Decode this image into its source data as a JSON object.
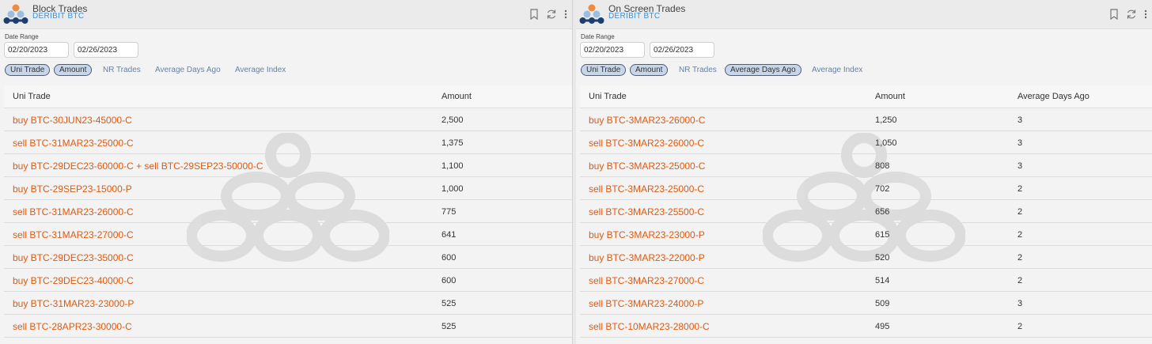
{
  "panels": [
    {
      "title": "Block Trades",
      "subtitle": "DERIBIT BTC",
      "date_range_label": "Date Range",
      "date_from": "02/20/2023",
      "date_to": "02/26/2023",
      "filters": [
        {
          "label": "Uni Trade",
          "active": true
        },
        {
          "label": "Amount",
          "active": true
        },
        {
          "label": "NR Trades",
          "active": false
        },
        {
          "label": "Average Days Ago",
          "active": false
        },
        {
          "label": "Average Index",
          "active": false
        }
      ],
      "columns": [
        "Uni Trade",
        "Amount"
      ],
      "rows": [
        [
          "buy BTC-30JUN23-45000-C",
          "2,500"
        ],
        [
          "sell BTC-31MAR23-25000-C",
          "1,375"
        ],
        [
          "buy BTC-29DEC23-60000-C + sell BTC-29SEP23-50000-C",
          "1,100"
        ],
        [
          "buy BTC-29SEP23-15000-P",
          "1,000"
        ],
        [
          "sell BTC-31MAR23-26000-C",
          "775"
        ],
        [
          "sell BTC-31MAR23-27000-C",
          "641"
        ],
        [
          "buy BTC-29DEC23-35000-C",
          "600"
        ],
        [
          "buy BTC-29DEC23-40000-C",
          "600"
        ],
        [
          "buy BTC-31MAR23-23000-P",
          "525"
        ],
        [
          "sell BTC-28APR23-30000-C",
          "525"
        ]
      ]
    },
    {
      "title": "On Screen Trades",
      "subtitle": "DERIBIT BTC",
      "date_range_label": "Date Range",
      "date_from": "02/20/2023",
      "date_to": "02/26/2023",
      "filters": [
        {
          "label": "Uni Trade",
          "active": true
        },
        {
          "label": "Amount",
          "active": true
        },
        {
          "label": "NR Trades",
          "active": false
        },
        {
          "label": "Average Days Ago",
          "active": true
        },
        {
          "label": "Average Index",
          "active": false
        }
      ],
      "columns": [
        "Uni Trade",
        "Amount",
        "Average Days Ago"
      ],
      "rows": [
        [
          "buy BTC-3MAR23-26000-C",
          "1,250",
          "3"
        ],
        [
          "sell BTC-3MAR23-26000-C",
          "1,050",
          "3"
        ],
        [
          "buy BTC-3MAR23-25000-C",
          "808",
          "3"
        ],
        [
          "sell BTC-3MAR23-25000-C",
          "702",
          "2"
        ],
        [
          "sell BTC-3MAR23-25500-C",
          "656",
          "2"
        ],
        [
          "buy BTC-3MAR23-23000-P",
          "615",
          "2"
        ],
        [
          "buy BTC-3MAR23-22000-P",
          "520",
          "2"
        ],
        [
          "sell BTC-3MAR23-27000-C",
          "514",
          "2"
        ],
        [
          "sell BTC-3MAR23-24000-P",
          "509",
          "3"
        ],
        [
          "sell BTC-10MAR23-28000-C",
          "495",
          "2"
        ]
      ]
    }
  ],
  "colors": {
    "trade_text": "#e05a10",
    "subtitle": "#3d8fd6",
    "pill_active_bg": "#c7d6ea",
    "pill_inactive_text": "#6782a3"
  },
  "icons": [
    "app-logo-icon",
    "bookmark-icon",
    "refresh-icon",
    "more-vertical-icon"
  ]
}
